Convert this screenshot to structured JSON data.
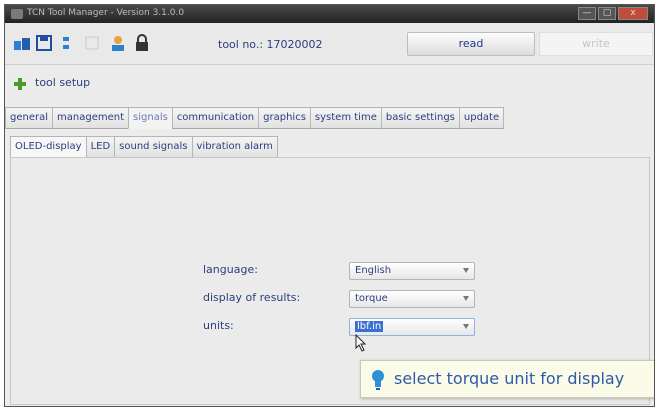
{
  "window": {
    "title": "TCN Tool Manager - Version 3.1.0.0",
    "controls": [
      "—",
      "▢",
      "x"
    ]
  },
  "toolbar": {
    "icons": [
      "open-icon",
      "save-icon",
      "sort-icon",
      "blank-icon",
      "user-icon",
      "lock-icon"
    ],
    "tool_no_label": "tool no.: 17020002",
    "read_label": "read",
    "write_label": "write"
  },
  "setup": {
    "label": "tool setup"
  },
  "tabs": [
    {
      "label": "general",
      "active": false
    },
    {
      "label": "management",
      "active": false
    },
    {
      "label": "signals",
      "active": true
    },
    {
      "label": "communication",
      "active": false
    },
    {
      "label": "graphics",
      "active": false
    },
    {
      "label": "system time",
      "active": false
    },
    {
      "label": "basic settings",
      "active": false
    },
    {
      "label": "update",
      "active": false
    }
  ],
  "subtabs": [
    {
      "label": "OLED-display",
      "active": true
    },
    {
      "label": "LED",
      "active": false
    },
    {
      "label": "sound signals",
      "active": false
    },
    {
      "label": "vibration alarm",
      "active": false
    }
  ],
  "form": {
    "language": {
      "label": "language:",
      "value": "English"
    },
    "display_results": {
      "label": "display of results:",
      "value": "torque"
    },
    "units": {
      "label": "units:",
      "value": "lbf.in"
    }
  },
  "tooltip": {
    "text": "select torque unit for display"
  },
  "colors": {
    "accent": "#1e3a8a",
    "tooltip_bg": "#fbfbe9",
    "selection": "#3b6fd1"
  }
}
